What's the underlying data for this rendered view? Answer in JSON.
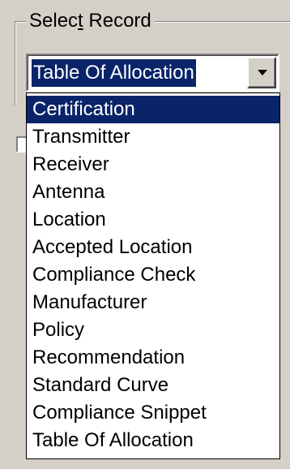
{
  "group": {
    "title_pre": "Selec",
    "title_accel": "t",
    "title_post": " Record"
  },
  "combo": {
    "value": "Table Of Allocation"
  },
  "dropdown": {
    "options": [
      "Certification",
      "Transmitter",
      "Receiver",
      "Antenna",
      "Location",
      "Accepted Location",
      "Compliance Check",
      "Manufacturer",
      "Policy",
      "Recommendation",
      "Standard Curve",
      "Compliance Snippet",
      "Table Of Allocation"
    ],
    "highlighted_index": 0
  },
  "colors": {
    "face": "#d4d0c8",
    "highlight": "#0a246a"
  }
}
